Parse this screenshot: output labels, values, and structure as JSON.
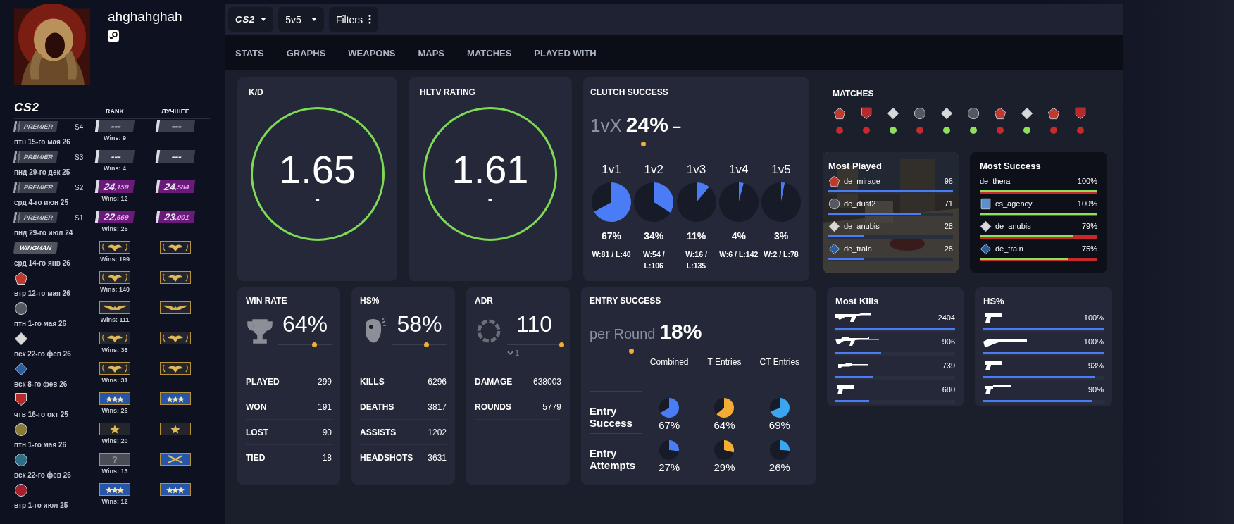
{
  "profile": {
    "name": "ahghahghah"
  },
  "sidebar": {
    "logo": "CS2",
    "columns": [
      "RANK",
      "ЛУЧШЕЕ"
    ],
    "rows": [
      {
        "kind": "premier",
        "label": "PREMIER",
        "season": "S4",
        "date": "птн 15-го мая 26",
        "rank": {
          "kind": "rating",
          "major": "---",
          "color": "#3a3e4c"
        },
        "wins": "Wins: 9",
        "best": {
          "kind": "rating",
          "major": "---",
          "color": "#3a3e4c"
        }
      },
      {
        "kind": "premier",
        "label": "PREMIER",
        "season": "S3",
        "date": "пнд 29-го дек 25",
        "rank": {
          "kind": "rating",
          "major": "---",
          "color": "#3a3e4c"
        },
        "wins": "Wins: 4",
        "best": {
          "kind": "rating",
          "major": "---",
          "color": "#3a3e4c"
        }
      },
      {
        "kind": "premier",
        "label": "PREMIER",
        "season": "S2",
        "date": "срд 4-го июн 25",
        "rank": {
          "kind": "rating",
          "major": "24",
          "minor": ",159",
          "color": "#6a1a78"
        },
        "wins": "Wins: 12",
        "best": {
          "kind": "rating",
          "major": "24",
          "minor": ",584",
          "color": "#6a1a78"
        }
      },
      {
        "kind": "premier",
        "label": "PREMIER",
        "season": "S1",
        "date": "пнд 29-го июл 24",
        "rank": {
          "kind": "rating",
          "major": "22",
          "minor": ",669",
          "color": "#6a1a78"
        },
        "wins": "Wins: 25",
        "best": {
          "kind": "rating",
          "major": "23",
          "minor": ",001",
          "color": "#6a1a78"
        }
      },
      {
        "kind": "wingman",
        "label": "WINGMAN",
        "date": "срд 14-го янв 26",
        "rank": {
          "kind": "eagle",
          "color": "#1c1f2a"
        },
        "wins": "Wins: 199",
        "best": {
          "kind": "eagle",
          "color": "#1c1f2a"
        }
      },
      {
        "kind": "map",
        "emblem": {
          "kind": "pentagon",
          "color": "#c0392b"
        },
        "date": "втр 12-го мая 26",
        "rank": {
          "kind": "eagle",
          "color": "#24262c"
        },
        "wins": "Wins: 140",
        "best": {
          "kind": "eagle",
          "color": "#24262c"
        }
      },
      {
        "kind": "map",
        "emblem": {
          "kind": "circle",
          "color": "#55595f"
        },
        "date": "птн 1-го мая 26",
        "rank": {
          "kind": "wings",
          "color": "#24262c"
        },
        "wins": "Wins: 111",
        "best": {
          "kind": "wings",
          "color": "#24262c"
        }
      },
      {
        "kind": "map",
        "emblem": {
          "kind": "diamond",
          "color": "#d8d8d8"
        },
        "date": "вск 22-го фев 26",
        "rank": {
          "kind": "eagle",
          "color": "#24262c"
        },
        "wins": "Wins: 38",
        "best": {
          "kind": "eagle",
          "color": "#24262c"
        }
      },
      {
        "kind": "map",
        "emblem": {
          "kind": "diamond",
          "color": "#2c5e9e"
        },
        "date": "вск 8-го фев 26",
        "rank": {
          "kind": "eagle",
          "color": "#24262c"
        },
        "wins": "Wins: 31",
        "best": {
          "kind": "eagle",
          "color": "#24262c"
        }
      },
      {
        "kind": "map",
        "emblem": {
          "kind": "shield",
          "color": "#b52a2a"
        },
        "date": "чтв 16-го окт 25",
        "rank": {
          "kind": "stars",
          "color": "#2556a8"
        },
        "wins": "Wins: 25",
        "best": {
          "kind": "stars",
          "color": "#2556a8"
        }
      },
      {
        "kind": "map",
        "emblem": {
          "kind": "circle",
          "color": "#8a7a3a"
        },
        "date": "птн 1-го мая 26",
        "rank": {
          "kind": "star",
          "color": "#24262c"
        },
        "wins": "Wins: 20",
        "best": {
          "kind": "star",
          "color": "#24262c"
        }
      },
      {
        "kind": "map",
        "emblem": {
          "kind": "circle",
          "color": "#2e6f86"
        },
        "date": "вск 22-го фев 26",
        "rank": {
          "kind": "unknown",
          "label": "?",
          "color": "#4a4d55"
        },
        "wins": "Wins: 13",
        "best": {
          "kind": "crossed",
          "color": "#2556a8"
        }
      },
      {
        "kind": "map",
        "emblem": {
          "kind": "circle",
          "color": "#a3212a"
        },
        "date": "втр 1-го июл 25",
        "rank": {
          "kind": "stars",
          "color": "#2556a8"
        },
        "wins": "Wins: 12",
        "best": {
          "kind": "stars",
          "color": "#2556a8"
        }
      }
    ]
  },
  "toolbar": {
    "game": "CS2",
    "mode": "5v5",
    "filters": "Filters"
  },
  "tabs": [
    "STATS",
    "GRAPHS",
    "WEAPONS",
    "MAPS",
    "MATCHES",
    "PLAYED WITH"
  ],
  "rating_cards": [
    {
      "title": "K/D",
      "value": "1.65",
      "change": "-"
    },
    {
      "title": "HLTV RATING",
      "value": "1.61",
      "change": "-"
    }
  ],
  "clutch": {
    "title": "CLUTCH SUCCESS",
    "prefix": "1vX",
    "value": "24%",
    "change": "–",
    "level": 0.25,
    "situations": [
      {
        "label": "1v1",
        "chart_data": {
          "type": "pie",
          "values": [
            67,
            33
          ]
        },
        "percent": "67%",
        "record": "W:81 / L:40"
      },
      {
        "label": "1v2",
        "chart_data": {
          "type": "pie",
          "values": [
            34,
            66
          ]
        },
        "percent": "34%",
        "record": "W:54 / L:106"
      },
      {
        "label": "1v3",
        "chart_data": {
          "type": "pie",
          "values": [
            11,
            89
          ]
        },
        "percent": "11%",
        "record": "W:16 / L:135"
      },
      {
        "label": "1v4",
        "chart_data": {
          "type": "pie",
          "values": [
            4,
            96
          ]
        },
        "percent": "4%",
        "record": "W:6 / L:142"
      },
      {
        "label": "1v5",
        "chart_data": {
          "type": "pie",
          "values": [
            3,
            97
          ]
        },
        "percent": "3%",
        "record": "W:2 / L:78"
      }
    ]
  },
  "matches": {
    "title": "MATCHES",
    "items": [
      {
        "emblem": {
          "kind": "pentagon",
          "color": "#c0392b"
        },
        "win": false
      },
      {
        "emblem": {
          "kind": "shield",
          "color": "#b52a2a"
        },
        "win": false
      },
      {
        "emblem": {
          "kind": "diamond",
          "color": "#d8d8d8"
        },
        "win": true
      },
      {
        "emblem": {
          "kind": "circle",
          "color": "#55595f"
        },
        "win": false
      },
      {
        "emblem": {
          "kind": "diamond",
          "color": "#d8d8d8"
        },
        "win": true
      },
      {
        "emblem": {
          "kind": "circle",
          "color": "#55595f"
        },
        "win": true
      },
      {
        "emblem": {
          "kind": "pentagon",
          "color": "#c0392b"
        },
        "win": false
      },
      {
        "emblem": {
          "kind": "diamond",
          "color": "#d8d8d8"
        },
        "win": true
      },
      {
        "emblem": {
          "kind": "pentagon",
          "color": "#c0392b"
        },
        "win": false
      },
      {
        "emblem": {
          "kind": "shield",
          "color": "#b52a2a"
        },
        "win": false
      }
    ]
  },
  "most_played": {
    "title": "Most Played",
    "items": [
      {
        "emblem": {
          "kind": "pentagon",
          "color": "#c0392b"
        },
        "name": "de_mirage",
        "count": "96",
        "level": 1.0
      },
      {
        "emblem": {
          "kind": "circle",
          "color": "#55595f"
        },
        "name": "de_dust2",
        "count": "71",
        "level": 0.74
      },
      {
        "emblem": {
          "kind": "diamond",
          "color": "#d8d8d8"
        },
        "name": "de_anubis",
        "count": "28",
        "level": 0.29
      },
      {
        "emblem": {
          "kind": "diamond",
          "color": "#2c5e9e"
        },
        "name": "de_train",
        "count": "28",
        "level": 0.29
      }
    ]
  },
  "most_success": {
    "title": "Most Success",
    "items": [
      {
        "name": "de_thera",
        "value": "100%",
        "level": 1.0
      },
      {
        "emblem": {
          "kind": "square",
          "color": "#5b8fd0"
        },
        "name": "cs_agency",
        "value": "100%",
        "level": 1.0
      },
      {
        "emblem": {
          "kind": "diamond",
          "color": "#d8d8d8"
        },
        "name": "de_anubis",
        "value": "79%",
        "level": 0.79
      },
      {
        "emblem": {
          "kind": "diamond",
          "color": "#2c5e9e"
        },
        "name": "de_train",
        "value": "75%",
        "level": 0.75
      }
    ]
  },
  "stat_cards": [
    {
      "kind": "trophy",
      "title": "WIN RATE",
      "value": "64%",
      "level": 0.67,
      "change": {
        "kind": "flat",
        "text": "–"
      },
      "rows": [
        {
          "label": "PLAYED",
          "value": "299"
        },
        {
          "label": "WON",
          "value": "191"
        },
        {
          "label": "LOST",
          "value": "90"
        },
        {
          "label": "TIED",
          "value": "18"
        }
      ]
    },
    {
      "kind": "head",
      "title": "HS%",
      "value": "58%",
      "level": 0.62,
      "change": {
        "kind": "flat",
        "text": "–"
      },
      "rows": [
        {
          "label": "KILLS",
          "value": "6296"
        },
        {
          "label": "DEATHS",
          "value": "3817"
        },
        {
          "label": "ASSISTS",
          "value": "1202"
        },
        {
          "label": "HEADSHOTS",
          "value": "3631"
        }
      ]
    },
    {
      "kind": "ring",
      "title": "ADR",
      "value": "110",
      "level": 1.0,
      "change": {
        "kind": "down",
        "text": "1"
      },
      "rows": [
        {
          "label": "DAMAGE",
          "value": "638003"
        },
        {
          "label": "ROUNDS",
          "value": "5779"
        }
      ]
    }
  ],
  "entry": {
    "title": "ENTRY SUCCESS",
    "prefix": "per Round",
    "value": "18%",
    "level": 0.19,
    "columns": [
      "Combined",
      "T Entries",
      "CT Entries"
    ],
    "rows": [
      {
        "label": "Entry Success",
        "cells": [
          {
            "percent": "67%",
            "chart_data": {
              "type": "pie",
              "values": [
                67,
                33
              ]
            },
            "color": "#4a7cf6"
          },
          {
            "percent": "64%",
            "chart_data": {
              "type": "pie",
              "values": [
                64,
                36
              ]
            },
            "color": "#f5ac33"
          },
          {
            "percent": "69%",
            "chart_data": {
              "type": "pie",
              "values": [
                69,
                31
              ]
            },
            "color": "#3aa6f0"
          }
        ]
      },
      {
        "label": "Entry Attempts",
        "cells": [
          {
            "percent": "27%",
            "chart_data": {
              "type": "pie",
              "values": [
                27,
                73
              ]
            },
            "color": "#4a7cf6"
          },
          {
            "percent": "29%",
            "chart_data": {
              "type": "pie",
              "values": [
                29,
                71
              ]
            },
            "color": "#f5ac33"
          },
          {
            "percent": "26%",
            "chart_data": {
              "type": "pie",
              "values": [
                26,
                74
              ]
            },
            "color": "#3aa6f0"
          }
        ]
      }
    ]
  },
  "weapon_cards": [
    {
      "title": "Most Kills",
      "items": [
        {
          "kind": "ak",
          "value": "2404",
          "level": 1.0
        },
        {
          "kind": "m4",
          "value": "906",
          "level": 0.38
        },
        {
          "kind": "sniper",
          "value": "739",
          "level": 0.31
        },
        {
          "kind": "pistol",
          "value": "680",
          "level": 0.28
        }
      ]
    },
    {
      "title": "HS%",
      "items": [
        {
          "kind": "pistol",
          "value": "100%",
          "level": 1.0
        },
        {
          "kind": "shotgun",
          "value": "100%",
          "level": 1.0
        },
        {
          "kind": "pistol",
          "value": "93%",
          "level": 0.93
        },
        {
          "kind": "pistol-long",
          "value": "90%",
          "level": 0.9
        }
      ]
    }
  ]
}
